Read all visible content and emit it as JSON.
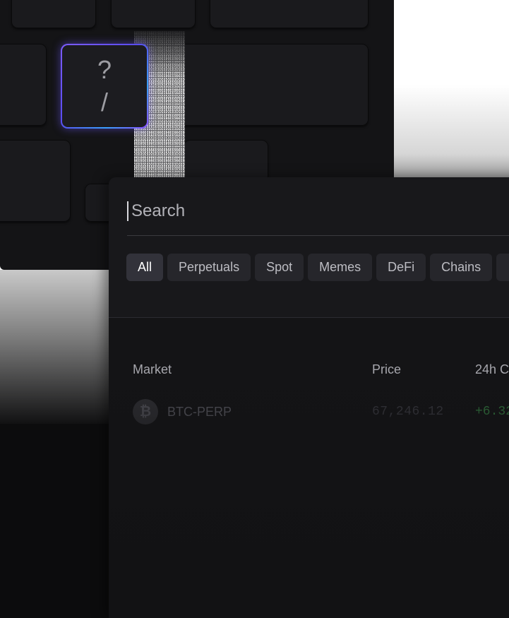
{
  "keyboard": {
    "shortcut_key": {
      "top_glyph": "?",
      "bottom_glyph": "/"
    }
  },
  "search": {
    "placeholder": "Search",
    "value": ""
  },
  "filters": {
    "chips": [
      "All",
      "Perpetuals",
      "Spot",
      "Memes",
      "DeFi",
      "Chains"
    ],
    "active": "All"
  },
  "table": {
    "columns": {
      "market": "Market",
      "price": "Price",
      "change": "24h C"
    },
    "rows": [
      {
        "icon": "bitcoin-icon",
        "icon_glyph": "₿",
        "market": "BTC-PERP",
        "price": "67,246.12",
        "change": "+6.32"
      }
    ]
  },
  "colors": {
    "positive": "#2f6b3a",
    "accent_glow": "#6e5aff"
  }
}
